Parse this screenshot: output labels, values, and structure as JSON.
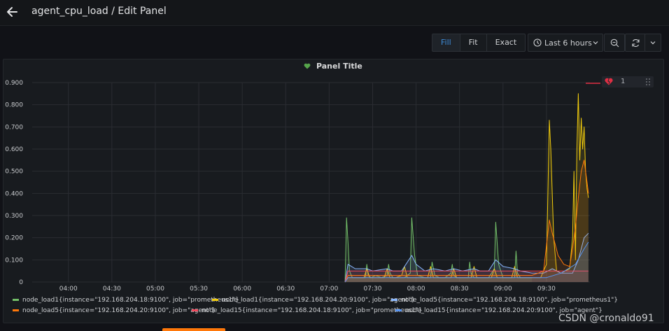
{
  "header": {
    "title": "agent_cpu_load / Edit Panel"
  },
  "toolbar": {
    "fill_label": "Fill",
    "fit_label": "Fit",
    "exact_label": "Exact",
    "time_range": "Last 6 hours"
  },
  "panel": {
    "title": "Panel Title",
    "annotation_value": "1"
  },
  "watermark": "CSDN @cronaldo91",
  "colors": {
    "green": "#73bf69",
    "yellow": "#f2cc0c",
    "light_blue": "#8ab8ff",
    "orange": "#ff780a",
    "red": "#f2495c",
    "blue": "#5794f2",
    "accent": "#3d8bd8"
  },
  "chart_data": {
    "type": "line",
    "x_ticks": [
      "04:00",
      "04:30",
      "05:00",
      "05:30",
      "06:00",
      "06:30",
      "07:00",
      "07:30",
      "08:00",
      "08:30",
      "09:00",
      "09:30"
    ],
    "y_ticks": [
      "0",
      "0.100",
      "0.200",
      "0.300",
      "0.400",
      "0.500",
      "0.600",
      "0.700",
      "0.800",
      "0.900"
    ],
    "ylim": [
      0,
      0.9
    ],
    "xlim_minutes": [
      215,
      600
    ],
    "grid": true,
    "legend_position": "bottom",
    "series": [
      {
        "name": "node_load1{instance=\"192.168.204.18:9100\", job=\"prometheus1\"}",
        "color": "#73bf69",
        "x": [
          431,
          432,
          433,
          434,
          436,
          438,
          445,
          446,
          447,
          449,
          452,
          456,
          460,
          461,
          462,
          464,
          467,
          472,
          476,
          477,
          479,
          481,
          486,
          490,
          491,
          493,
          496,
          500,
          504,
          505,
          506,
          508,
          511,
          516,
          517,
          518,
          520,
          524,
          530,
          534,
          535,
          537,
          540,
          548,
          549,
          550,
          552,
          556,
          560
        ],
        "y": [
          0,
          0.29,
          0.18,
          0.05,
          0.02,
          0.02,
          0.02,
          0.08,
          0.03,
          0.02,
          0.03,
          0.02,
          0.03,
          0.08,
          0.04,
          0.02,
          0.02,
          0.02,
          0.04,
          0.29,
          0.12,
          0.03,
          0.02,
          0.02,
          0.09,
          0.03,
          0.02,
          0.02,
          0.04,
          0.08,
          0.03,
          0.02,
          0.02,
          0.02,
          0.09,
          0.04,
          0.02,
          0.02,
          0.02,
          0.06,
          0.27,
          0.08,
          0.02,
          0.02,
          0.14,
          0.04,
          0.02,
          0.02,
          0.02
        ]
      },
      {
        "name": "node_load1{instance=\"192.168.204.20:9100\", job=\"agent\"}",
        "color": "#f2cc0c",
        "x": [
          431,
          433,
          440,
          444,
          446,
          448,
          452,
          458,
          460,
          462,
          466,
          470,
          472,
          474,
          478,
          482,
          488,
          490,
          492,
          496,
          500,
          504,
          506,
          508,
          512,
          518,
          520,
          522,
          526,
          532,
          534,
          536,
          540,
          546,
          548,
          550,
          554,
          560,
          566,
          570,
          572,
          573,
          575,
          577,
          580,
          583,
          586,
          588,
          589,
          590,
          591,
          592,
          593,
          594,
          595,
          596,
          597,
          598,
          599
        ],
        "y": [
          0,
          0.02,
          0.02,
          0.02,
          0.06,
          0.02,
          0.02,
          0.02,
          0.06,
          0.02,
          0.02,
          0.03,
          0.07,
          0.02,
          0.02,
          0.02,
          0.02,
          0.07,
          0.02,
          0.02,
          0.02,
          0.02,
          0.06,
          0.02,
          0.02,
          0.02,
          0.07,
          0.02,
          0.02,
          0.02,
          0.06,
          0.02,
          0.02,
          0.02,
          0.07,
          0.02,
          0.02,
          0.02,
          0.02,
          0.08,
          0.73,
          0.6,
          0.2,
          0.05,
          0.04,
          0.05,
          0.06,
          0.2,
          0.5,
          0.1,
          0.6,
          0.85,
          0.55,
          0.74,
          0.6,
          0.7,
          0.5,
          0.42,
          0.38
        ]
      },
      {
        "name": "node_load5{instance=\"192.168.204.18:9100\", job=\"prometheus1\"}",
        "color": "#8ab8ff",
        "x": [
          431,
          433,
          438,
          446,
          450,
          460,
          464,
          470,
          477,
          480,
          486,
          492,
          500,
          506,
          512,
          520,
          524,
          530,
          535,
          540,
          548,
          552,
          560,
          568,
          574,
          580,
          588,
          592,
          596,
          599
        ],
        "y": [
          0,
          0.08,
          0.06,
          0.06,
          0.05,
          0.06,
          0.05,
          0.05,
          0.12,
          0.08,
          0.05,
          0.06,
          0.05,
          0.06,
          0.05,
          0.06,
          0.05,
          0.05,
          0.1,
          0.07,
          0.06,
          0.05,
          0.04,
          0.04,
          0.06,
          0.04,
          0.04,
          0.1,
          0.2,
          0.22
        ]
      },
      {
        "name": "node_load5{instance=\"192.168.204.20:9100\", job=\"agent\"}",
        "color": "#ff780a",
        "x": [
          431,
          433,
          440,
          450,
          460,
          470,
          480,
          490,
          500,
          510,
          520,
          530,
          540,
          550,
          560,
          568,
          572,
          574,
          578,
          582,
          586,
          588,
          590,
          592,
          594,
          596,
          598,
          599
        ],
        "y": [
          0,
          0.03,
          0.03,
          0.03,
          0.03,
          0.03,
          0.03,
          0.03,
          0.03,
          0.03,
          0.03,
          0.03,
          0.03,
          0.03,
          0.03,
          0.05,
          0.28,
          0.22,
          0.12,
          0.08,
          0.07,
          0.15,
          0.25,
          0.38,
          0.5,
          0.55,
          0.45,
          0.4
        ]
      },
      {
        "name": "node_load15{instance=\"192.168.204.18:9100\", job=\"prometheus1\"}",
        "color": "#f2495c",
        "x": [
          431,
          433,
          599
        ],
        "y": [
          0,
          0.05,
          0.05
        ]
      },
      {
        "name": "node_load15{instance=\"192.168.204.20:9100\", job=\"agent\"}",
        "color": "#5794f2",
        "x": [
          431,
          433,
          570,
          580,
          590,
          596,
          599
        ],
        "y": [
          0,
          0.02,
          0.02,
          0.04,
          0.08,
          0.15,
          0.18
        ]
      }
    ]
  }
}
